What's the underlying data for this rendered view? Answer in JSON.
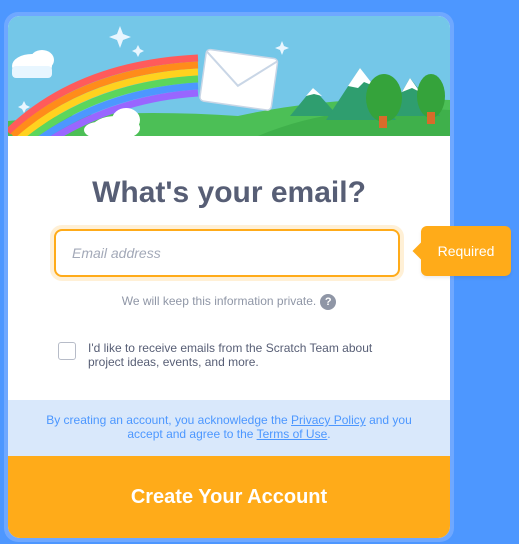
{
  "title": "What's your email?",
  "email_field": {
    "placeholder": "Email address",
    "value": ""
  },
  "privacy_note": "We will keep this information private.",
  "help_icon_glyph": "?",
  "consent": {
    "checked": false,
    "label": "I'd like to receive emails from the Scratch Team about project ideas, events, and more."
  },
  "disclaimer": {
    "prefix": "By creating an account, you acknowledge the ",
    "privacy_link": "Privacy Policy",
    "middle": " and you accept and agree to the ",
    "terms_link": "Terms of Use",
    "suffix": "."
  },
  "create_button": "Create Your Account",
  "validation_tooltip": "Required",
  "colors": {
    "background": "#4d97ff",
    "accent": "#ffab19",
    "text": "#575e75",
    "link": "#4c97ff",
    "banner": "#d9e8fb"
  }
}
